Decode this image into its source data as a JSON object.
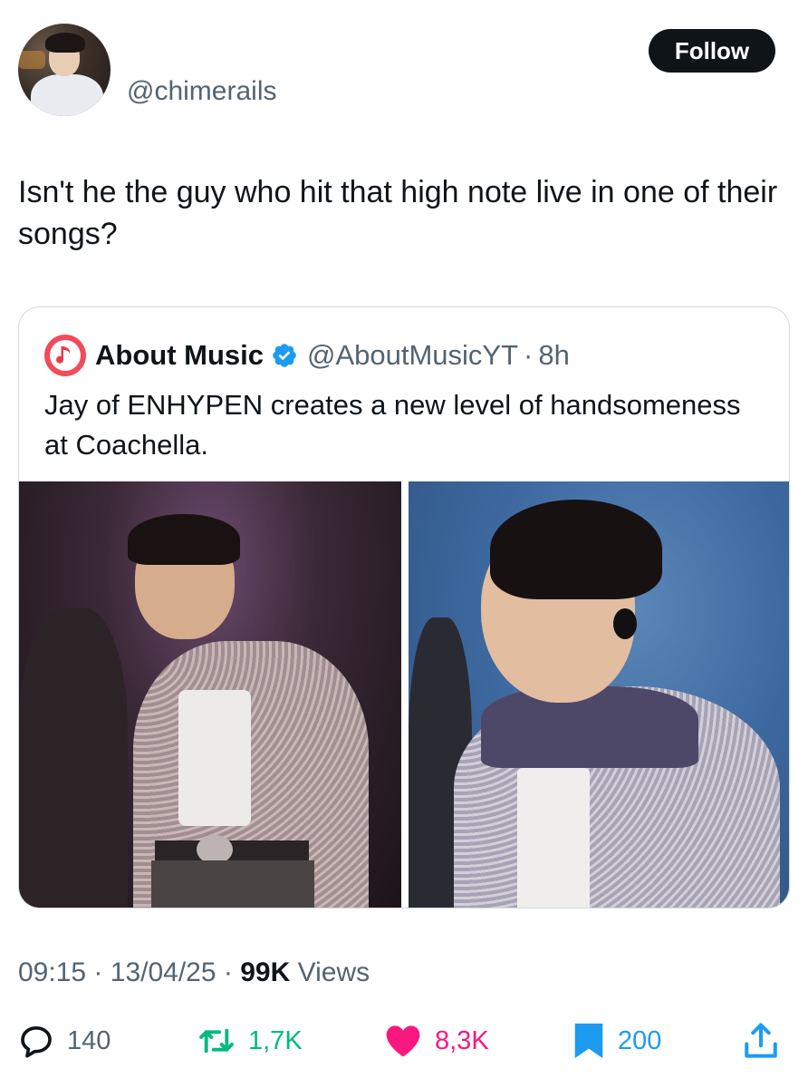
{
  "author": {
    "handle": "@chimerails"
  },
  "follow_button": {
    "label": "Follow"
  },
  "tweet": {
    "text": "Isn't he the guy who hit that high note live in one of their songs?"
  },
  "quoted_tweet": {
    "name": "About Music",
    "handle": "@AboutMusicYT",
    "separator": "·",
    "time": "8h",
    "text": "Jay of ENHYPEN creates a new level of handsomeness at Coachella.",
    "avatar_icon": "music-note-icon",
    "verified_icon": "verified-badge-icon"
  },
  "meta": {
    "time": "09:15",
    "sep1": "·",
    "date": "13/04/25",
    "sep2": "·",
    "views_count": "99K",
    "views_label": "Views"
  },
  "actions": {
    "reply_count": "140",
    "retweet_count": "1,7K",
    "like_count": "8,3K",
    "bookmark_count": "200"
  },
  "colors": {
    "follow_bg": "#0f1419",
    "secondary_text": "#536471",
    "retweet": "#00ba7c",
    "like": "#f91880",
    "bookmark": "#1d9bf0",
    "verified": "#1d9bf0"
  }
}
